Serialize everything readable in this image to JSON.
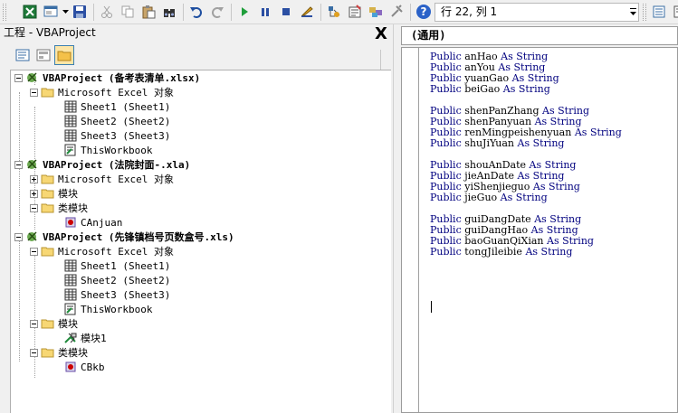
{
  "toolbar": {
    "status_text": "行 22, 列 1",
    "icons": [
      "excel-view-icon",
      "insert-userform-icon",
      "save-icon",
      "cut-icon",
      "copy-icon",
      "paste-icon",
      "find-icon",
      "undo-icon",
      "redo-icon",
      "run-icon",
      "break-icon",
      "reset-icon",
      "design-mode-icon",
      "project-explorer-icon",
      "properties-icon",
      "object-browser-icon",
      "toolbox-icon",
      "help-icon"
    ]
  },
  "project_pane": {
    "title": "工程 - VBAProject",
    "close_label": "X"
  },
  "tree": [
    {
      "id": "p1",
      "label": "VBAProject (备考表清单.xlsx)",
      "bold": true
    },
    {
      "id": "p1-excel",
      "label": "Microsoft Excel 对象"
    },
    {
      "id": "p1-s1",
      "label": "Sheet1 (Sheet1)"
    },
    {
      "id": "p1-s2",
      "label": "Sheet2 (Sheet2)"
    },
    {
      "id": "p1-s3",
      "label": "Sheet3 (Sheet3)"
    },
    {
      "id": "p1-wb",
      "label": "ThisWorkbook"
    },
    {
      "id": "p2",
      "label": "VBAProject (法院封面-.xla)",
      "bold": true
    },
    {
      "id": "p2-excel",
      "label": "Microsoft Excel 对象"
    },
    {
      "id": "p2-mod",
      "label": "模块"
    },
    {
      "id": "p2-cls",
      "label": "类模块"
    },
    {
      "id": "p2-canjuan",
      "label": "CAnjuan"
    },
    {
      "id": "p3",
      "label": "VBAProject (先锋镇档号页数盒号.xls)",
      "bold": true
    },
    {
      "id": "p3-excel",
      "label": "Microsoft Excel 对象"
    },
    {
      "id": "p3-s1",
      "label": "Sheet1 (Sheet1)"
    },
    {
      "id": "p3-s2",
      "label": "Sheet2 (Sheet2)"
    },
    {
      "id": "p3-s3",
      "label": "Sheet3 (Sheet3)"
    },
    {
      "id": "p3-wb",
      "label": "ThisWorkbook"
    },
    {
      "id": "p3-mod",
      "label": "模块"
    },
    {
      "id": "p3-mod1",
      "label": "模块1"
    },
    {
      "id": "p3-cls",
      "label": "类模块"
    },
    {
      "id": "p3-cbkb",
      "label": "CBkb"
    }
  ],
  "code_pane": {
    "object_combo": "(通用)",
    "lines": [
      {
        "kw": "Public",
        "id": "anHao",
        "as": "As",
        "type": "String"
      },
      {
        "kw": "Public",
        "id": "anYou",
        "as": "As",
        "type": "String"
      },
      {
        "kw": "Public",
        "id": "yuanGao",
        "as": "As",
        "type": "String"
      },
      {
        "kw": "Public",
        "id": "beiGao",
        "as": "As",
        "type": "String"
      },
      {
        "blank": true
      },
      {
        "kw": "Public",
        "id": "shenPanZhang",
        "as": "As",
        "type": "String"
      },
      {
        "kw": "Public",
        "id": "shenPanyuan",
        "as": "As",
        "type": "String"
      },
      {
        "kw": "Public",
        "id": "renMingpeishenyuan",
        "as": "As",
        "type": "String"
      },
      {
        "kw": "Public",
        "id": "shuJiYuan",
        "as": "As",
        "type": "String"
      },
      {
        "blank": true
      },
      {
        "kw": "Public",
        "id": "shouAnDate",
        "as": "As",
        "type": "String"
      },
      {
        "kw": "Public",
        "id": "jieAnDate",
        "as": "As",
        "type": "String"
      },
      {
        "kw": "Public",
        "id": "yiShenjieguo",
        "as": "As",
        "type": "String"
      },
      {
        "kw": "Public",
        "id": "jieGuo",
        "as": "As",
        "type": "String"
      },
      {
        "blank": true
      },
      {
        "kw": "Public",
        "id": "guiDangDate",
        "as": "As",
        "type": "String"
      },
      {
        "kw": "Public",
        "id": "guiDangHao",
        "as": "As",
        "type": "String"
      },
      {
        "kw": "Public",
        "id": "baoGuanQiXian",
        "as": "As",
        "type": "String"
      },
      {
        "kw": "Public",
        "id": "tongJileibie",
        "as": "As",
        "type": "String"
      }
    ]
  }
}
